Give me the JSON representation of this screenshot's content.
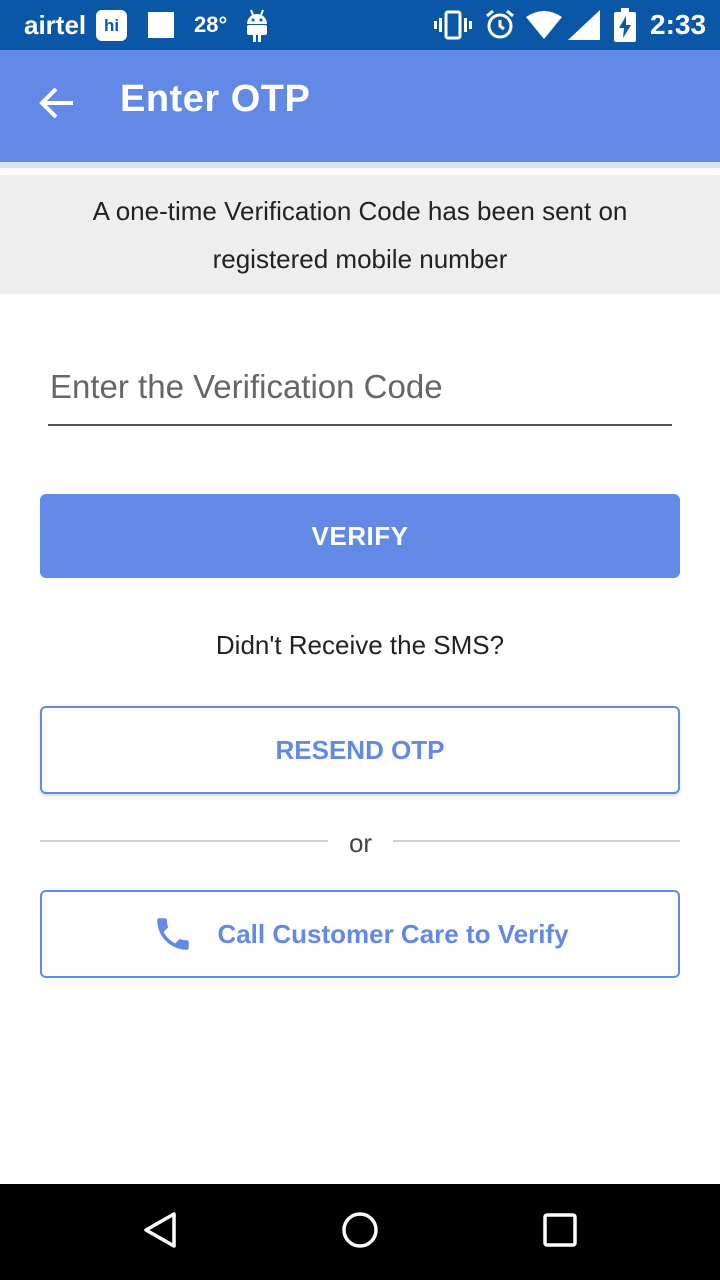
{
  "status_bar": {
    "carrier": "airtel",
    "hike_badge": "hi",
    "temperature": "28°",
    "time": "2:33",
    "icons": [
      "hike-icon",
      "notification-square-icon",
      "android-icon",
      "vibrate-icon",
      "alarm-icon",
      "wifi-icon",
      "signal-icon",
      "battery-charging-icon"
    ]
  },
  "app_bar": {
    "title": "Enter OTP",
    "back_icon": "arrow-left-icon"
  },
  "info": {
    "message": "A one-time Verification Code has been sent on registered mobile number"
  },
  "form": {
    "otp_placeholder": "Enter the Verification Code",
    "otp_value": "",
    "verify_label": "VERIFY"
  },
  "resend": {
    "question": "Didn't Receive the SMS?",
    "resend_label": "RESEND OTP"
  },
  "divider": {
    "text": "or"
  },
  "call": {
    "label": "Call Customer Care to Verify",
    "icon": "phone-icon"
  },
  "nav": {
    "icons": [
      "nav-back-icon",
      "nav-home-icon",
      "nav-recent-icon"
    ]
  },
  "colors": {
    "primary": "#6389e6",
    "status_bar": "#0a57a8",
    "banner_bg": "#eeeeee"
  }
}
